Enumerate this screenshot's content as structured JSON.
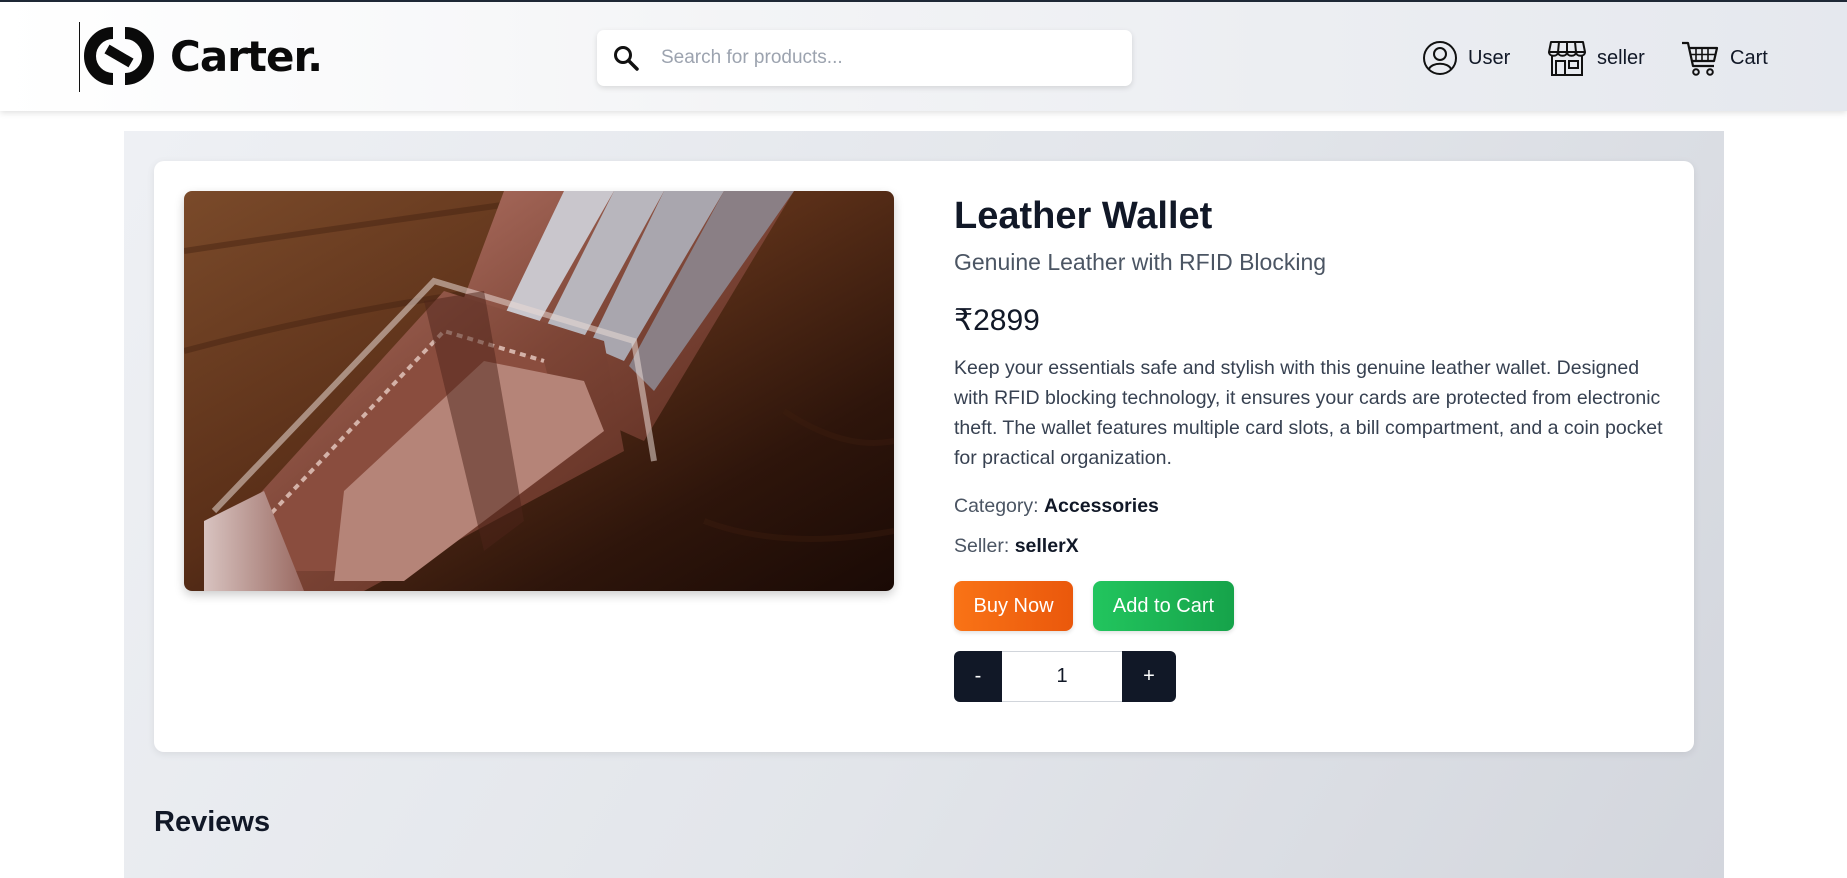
{
  "header": {
    "logo_text": "Carter.",
    "search": {
      "placeholder": "Search for products...",
      "value": ""
    },
    "nav": {
      "user_label": "User",
      "seller_label": "seller",
      "cart_label": "Cart"
    }
  },
  "product": {
    "title": "Leather Wallet",
    "subtitle": "Genuine Leather with RFID Blocking",
    "price": "₹2899",
    "description": "Keep your essentials safe and stylish with this genuine leather wallet. Designed with RFID blocking technology, it ensures your cards are protected from electronic theft. The wallet features multiple card slots, a bill compartment, and a coin pocket for practical organization.",
    "category_label": "Category:",
    "category_value": "Accessories",
    "seller_label": "Seller:",
    "seller_value": "sellerX",
    "buy_now_label": "Buy Now",
    "add_to_cart_label": "Add to Cart",
    "quantity": {
      "minus_label": "-",
      "value": "1",
      "plus_label": "+"
    }
  },
  "reviews": {
    "title": "Reviews"
  },
  "colors": {
    "buy_now": "#f97316",
    "add_to_cart": "#22c55e",
    "quantity_buttons": "#111827"
  },
  "icons": [
    "logo-mark-icon",
    "search-icon",
    "user-icon",
    "store-icon",
    "cart-icon"
  ]
}
